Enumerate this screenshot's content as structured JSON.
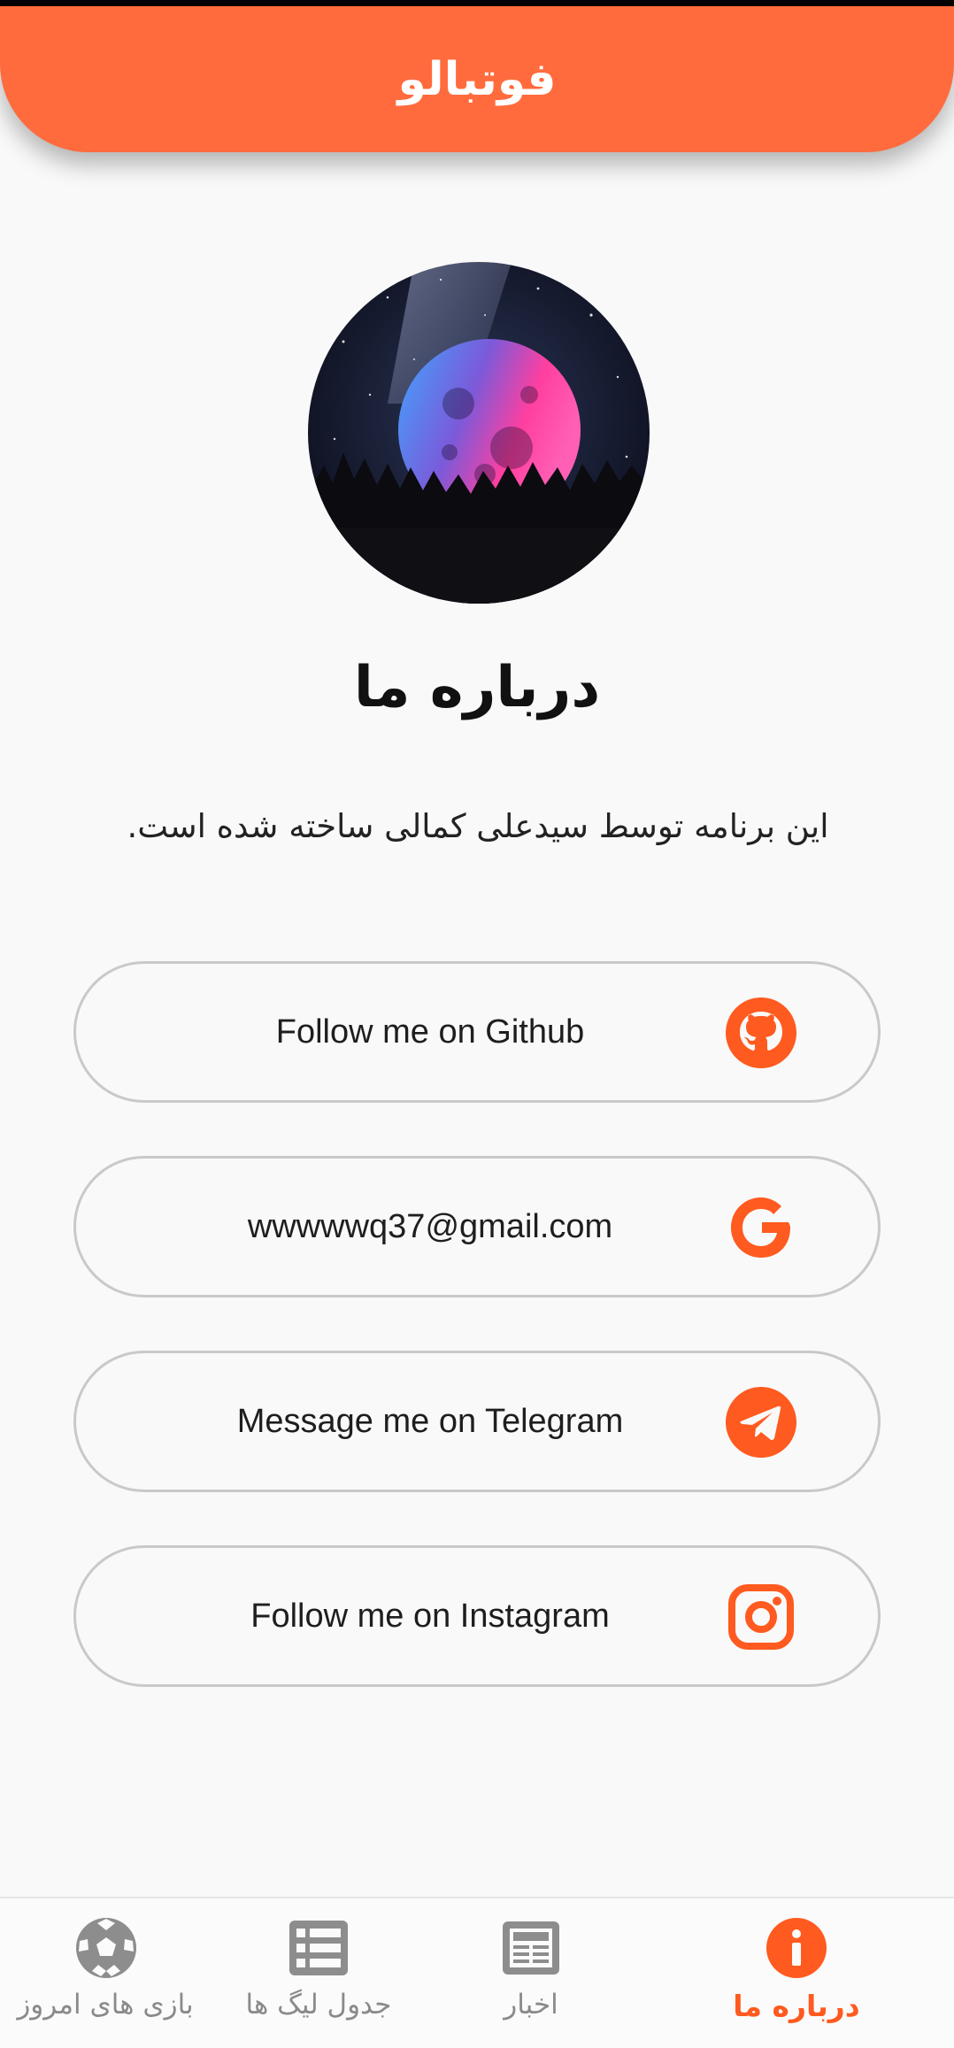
{
  "app_bar": {
    "title": "فوتبالو"
  },
  "about": {
    "title": "درباره ما",
    "description": "این برنامه توسط سیدعلی کمالی ساخته شده است."
  },
  "links": [
    {
      "label": "Follow me on Github",
      "icon": "github-icon"
    },
    {
      "label": "wwwwwq37@gmail.com",
      "icon": "google-icon"
    },
    {
      "label": "Message me on Telegram",
      "icon": "telegram-icon"
    },
    {
      "label": "Follow me on Instagram",
      "icon": "instagram-icon"
    }
  ],
  "bottom_nav": {
    "items": [
      {
        "label": "بازی های امروز",
        "icon": "soccer-ball-icon",
        "active": false
      },
      {
        "label": "جدول لیگ ها",
        "icon": "table-list-icon",
        "active": false
      },
      {
        "label": "اخبار",
        "icon": "newspaper-icon",
        "active": false
      },
      {
        "label": "درباره ما",
        "icon": "info-icon",
        "active": true
      }
    ]
  },
  "colors": {
    "accent": "#ff6b3d",
    "accent_icon": "#ff5a1f",
    "inactive": "#8a8a8a",
    "background": "#f9f9f9"
  }
}
